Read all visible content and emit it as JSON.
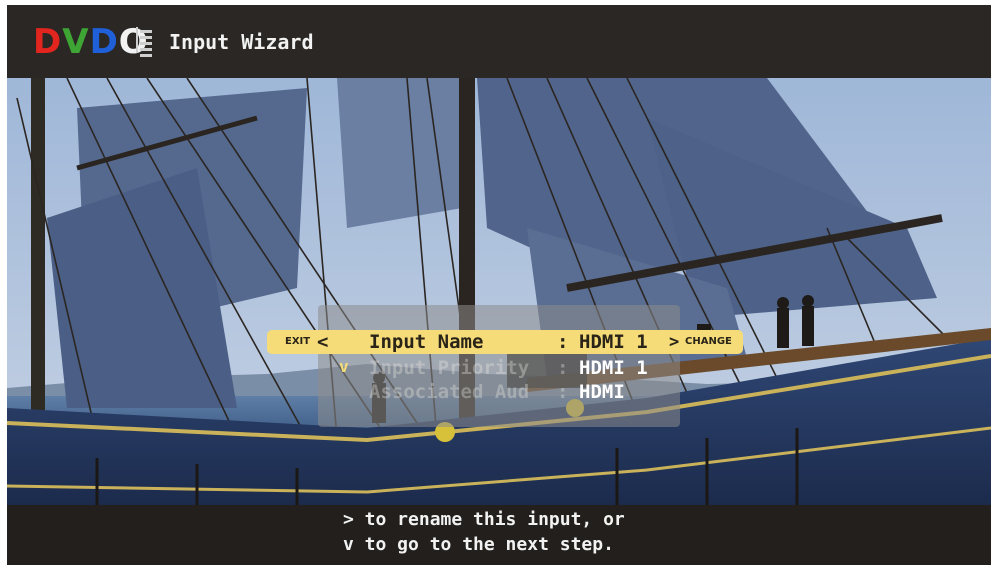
{
  "header": {
    "logo_letters": [
      {
        "char": "D",
        "color": "#e2261f"
      },
      {
        "char": "V",
        "color": "#3ea535"
      },
      {
        "char": "D",
        "color": "#1f5fd8"
      },
      {
        "char": "O",
        "color": "#f2f2f2"
      }
    ],
    "title": "Input Wizard"
  },
  "menu": {
    "exit_label": "EXIT",
    "left_arrow": "<",
    "right_arrow": ">",
    "change_label": "CHANGE",
    "down_arrow": "v",
    "rows": [
      {
        "label": "Input Name",
        "colon": ":",
        "value": "HDMI 1"
      },
      {
        "label": "Input Priority",
        "colon": ":",
        "value": "HDMI 1"
      },
      {
        "label": "Associated Aud",
        "colon": ":",
        "value": "HDMI"
      }
    ]
  },
  "footer": {
    "line1": "> to rename this input, or",
    "line2": "v to go to the next step."
  },
  "colors": {
    "highlight": "#f5dc78",
    "background": "#221f1c",
    "text": "#f2f2f2"
  }
}
